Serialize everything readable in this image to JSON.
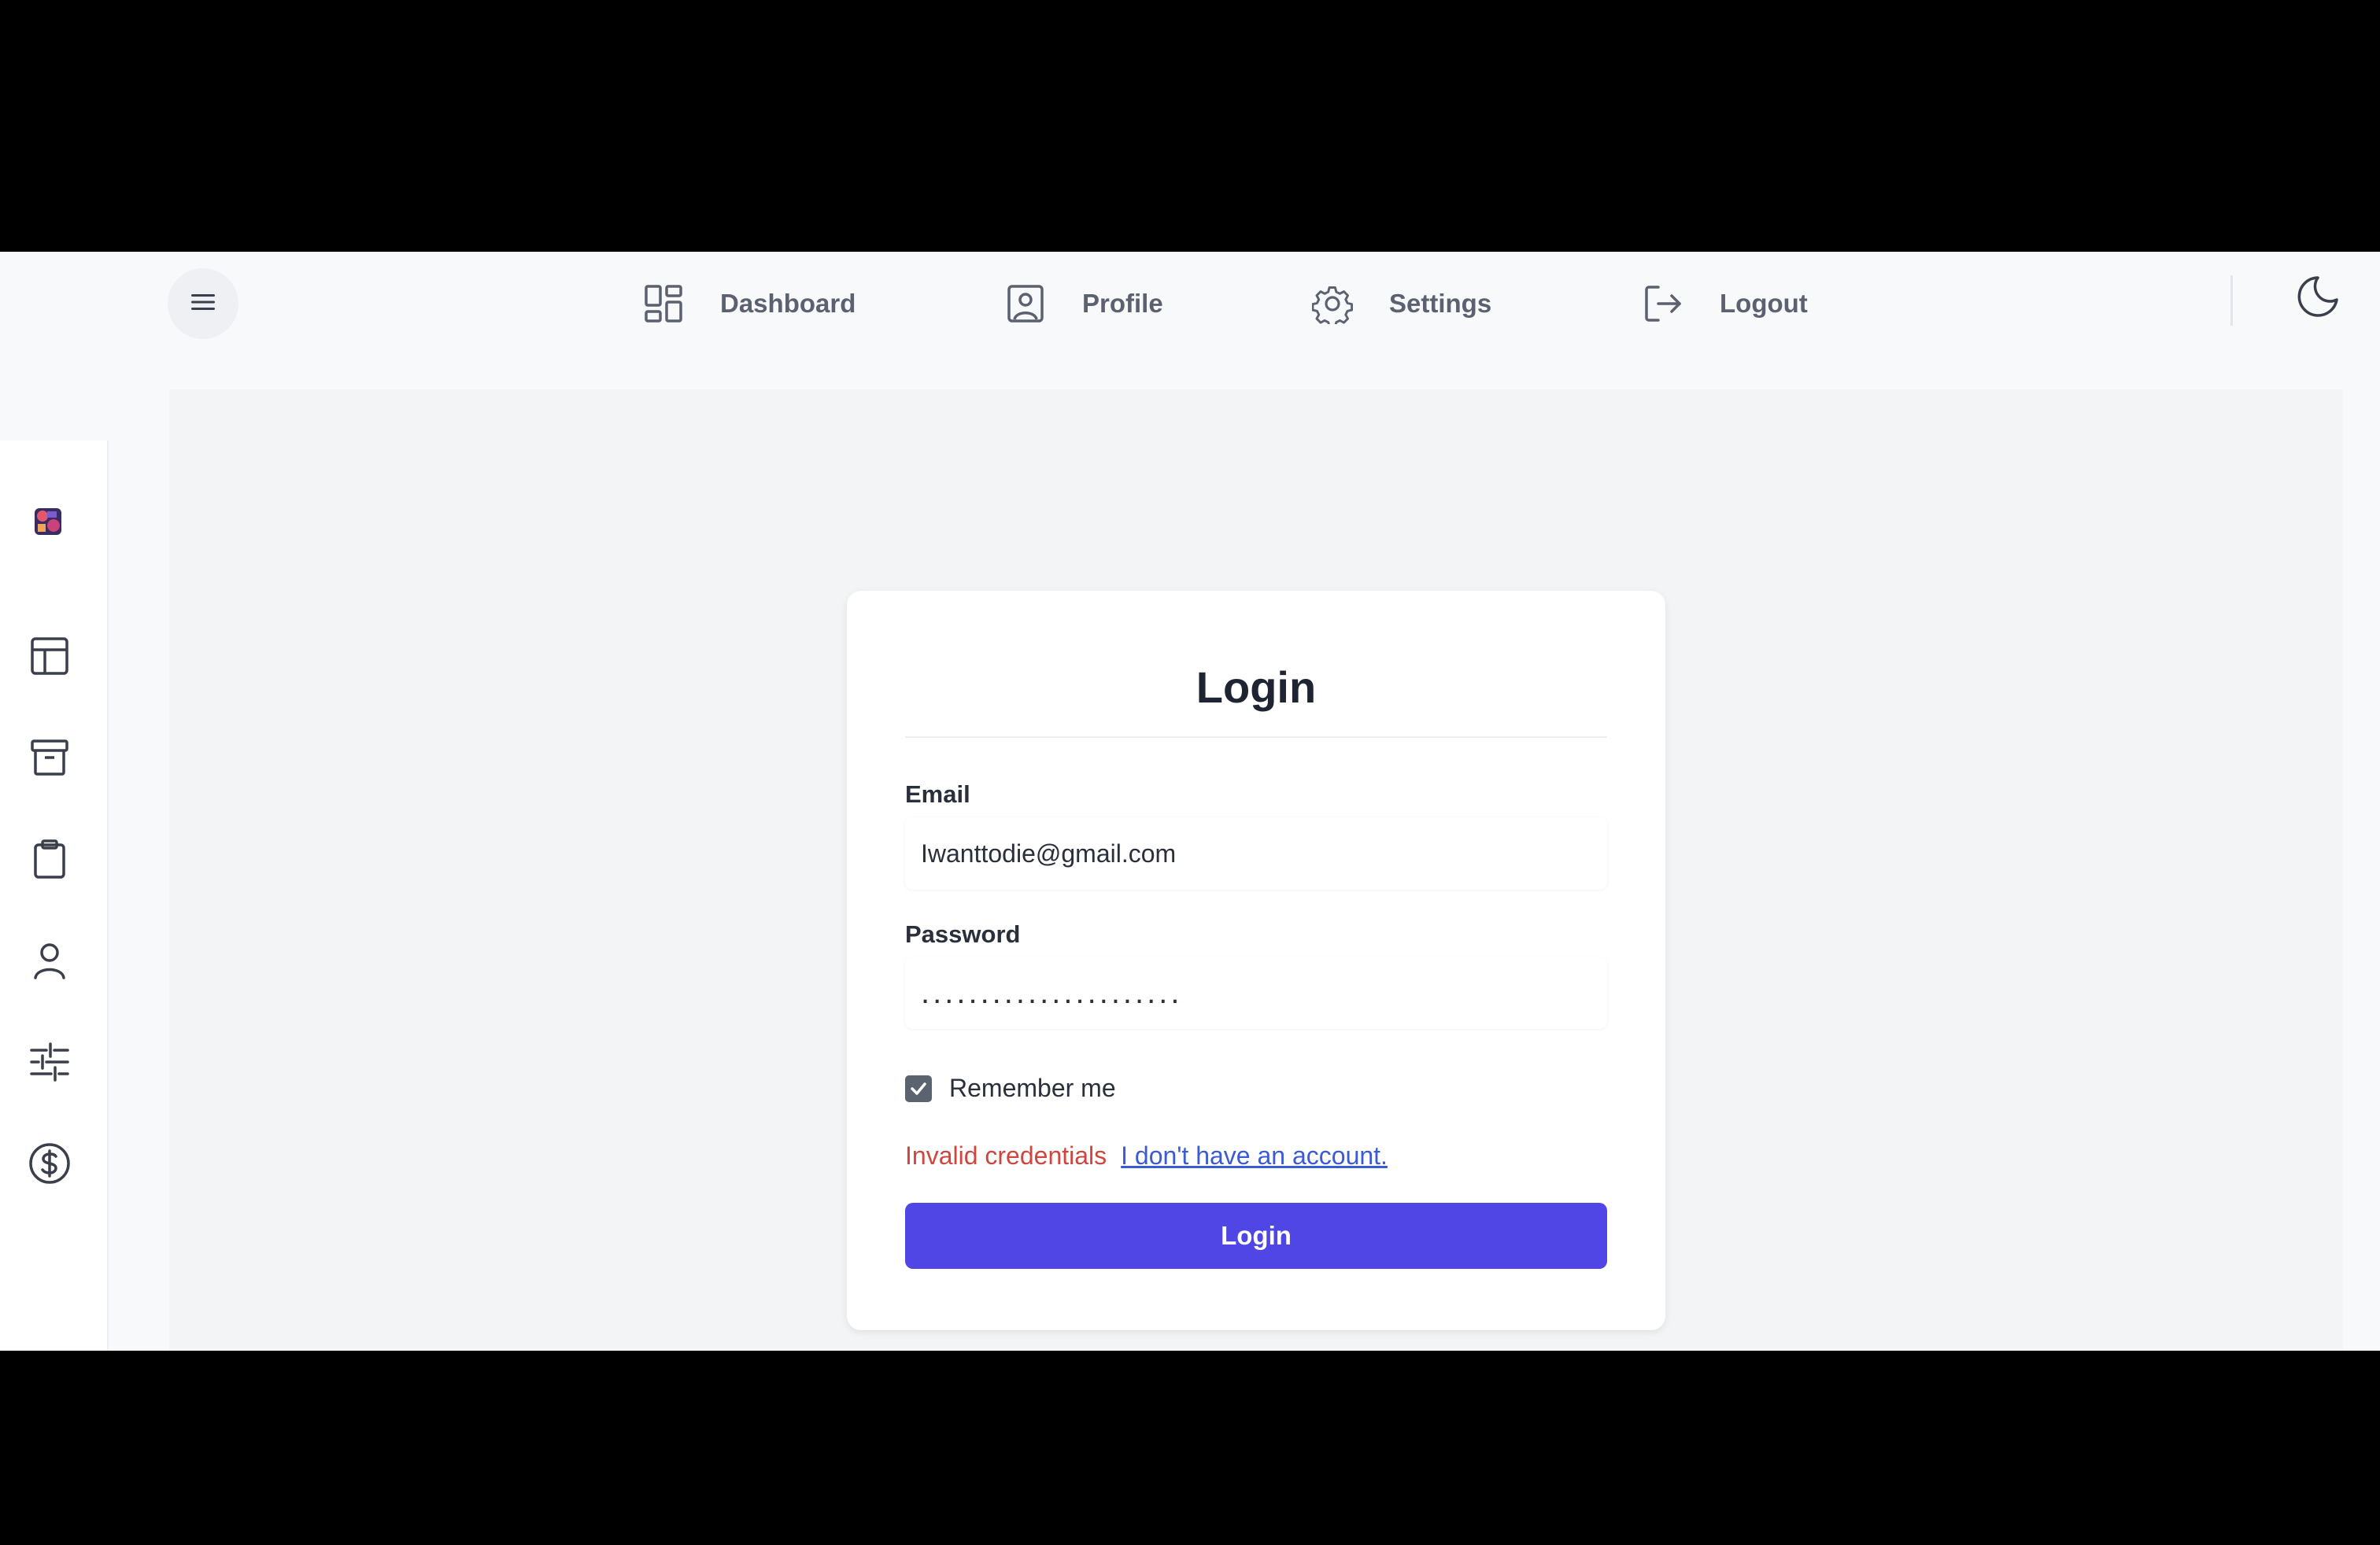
{
  "nav": {
    "items": [
      {
        "label": "Dashboard",
        "icon": "dashboard-grid-icon"
      },
      {
        "label": "Profile",
        "icon": "profile-card-icon"
      },
      {
        "label": "Settings",
        "icon": "gear-icon"
      },
      {
        "label": "Logout",
        "icon": "logout-icon"
      }
    ],
    "menu_icon": "hamburger-menu-icon",
    "theme_icon": "moon-icon"
  },
  "sidebar": {
    "logo_icon": "app-logo-icon",
    "items": [
      {
        "icon": "layout-icon"
      },
      {
        "icon": "archive-icon"
      },
      {
        "icon": "clipboard-icon"
      },
      {
        "icon": "user-icon"
      },
      {
        "icon": "sliders-icon"
      },
      {
        "icon": "dollar-circle-icon"
      }
    ]
  },
  "login": {
    "title": "Login",
    "email_label": "Email",
    "email_value": "Iwanttodie@gmail.com",
    "password_label": "Password",
    "password_value": "......................",
    "remember_label": "Remember me",
    "remember_checked": true,
    "error_message": "Invalid credentials",
    "signup_link": "I don't have an account.",
    "submit_label": "Login"
  },
  "colors": {
    "primary": "#4f46e5",
    "error": "#d0463f",
    "link": "#3b5bd6"
  }
}
